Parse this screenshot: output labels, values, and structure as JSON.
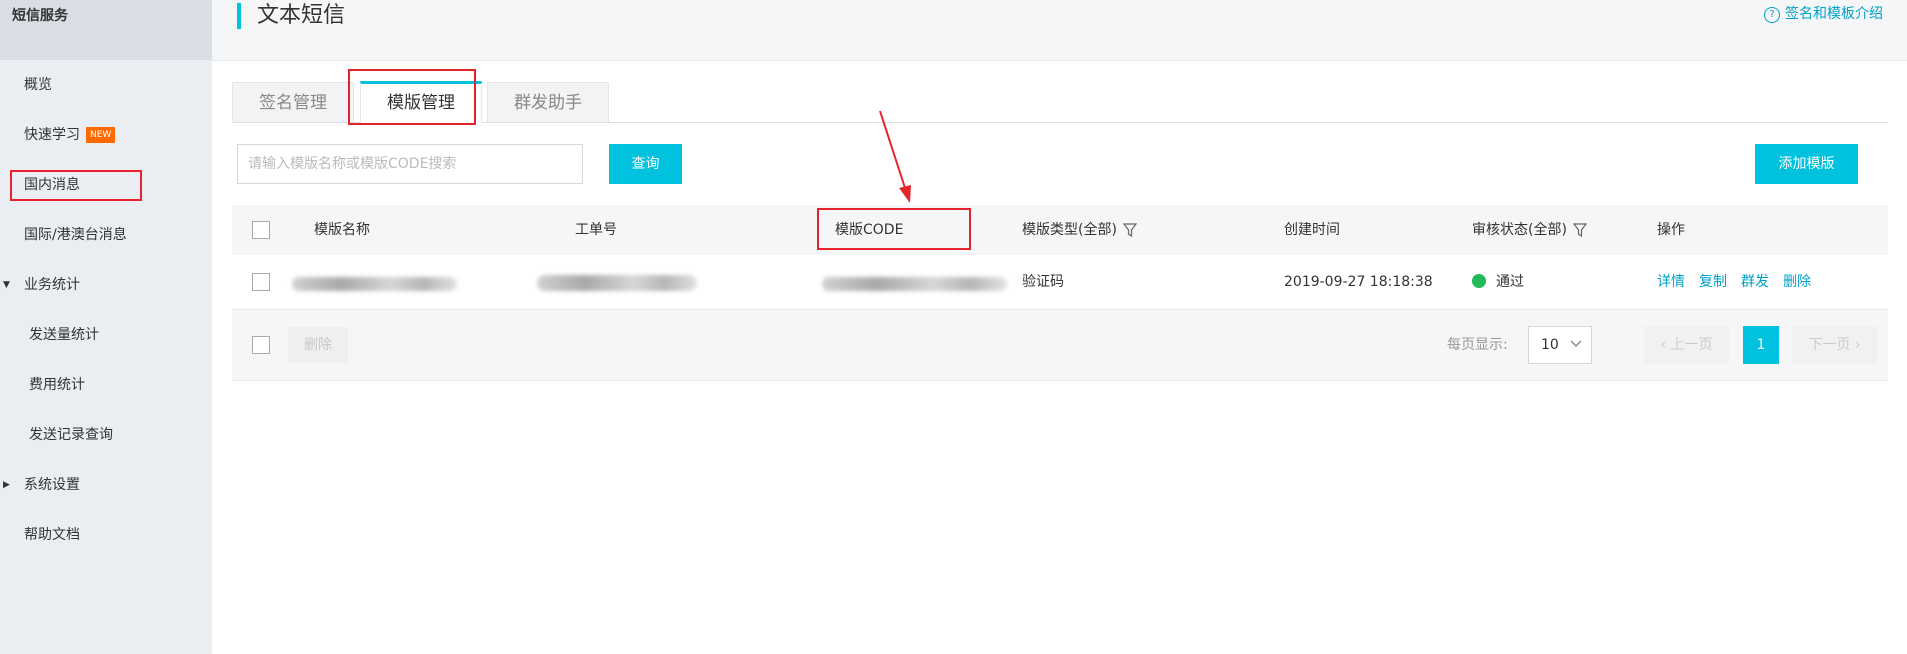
{
  "sidebar": {
    "header": "短信服务",
    "items": [
      {
        "label": "概览"
      },
      {
        "label": "快速学习",
        "badge": "NEW"
      },
      {
        "label": "国内消息"
      },
      {
        "label": "国际/港澳台消息"
      },
      {
        "label": "业务统计"
      },
      {
        "label": "发送量统计"
      },
      {
        "label": "费用统计"
      },
      {
        "label": "发送记录查询"
      },
      {
        "label": "系统设置"
      },
      {
        "label": "帮助文档"
      }
    ]
  },
  "header": {
    "title": "文本短信",
    "help_link": "签名和模板介绍"
  },
  "tabs": [
    {
      "label": "签名管理"
    },
    {
      "label": "模版管理"
    },
    {
      "label": "群发助手"
    }
  ],
  "toolbar": {
    "search_placeholder": "请输入模版名称或模版CODE搜索",
    "search_button": "查询",
    "add_button": "添加模版"
  },
  "table": {
    "columns": [
      "模版名称",
      "工单号",
      "模版CODE",
      "模版类型(全部)",
      "创建时间",
      "审核状态(全部)",
      "操作"
    ],
    "rows": [
      {
        "type": "验证码",
        "created": "2019-09-27 18:18:38",
        "status": "通过",
        "actions": [
          "详情",
          "复制",
          "群发",
          "删除"
        ]
      }
    ]
  },
  "footer": {
    "delete_button": "删除",
    "per_page_label": "每页显示:",
    "per_page_value": "10",
    "prev_label": "上一页",
    "current_page": "1",
    "next_label": "下一页"
  },
  "colors": {
    "accent": "#00c1de",
    "link": "#00a2ca",
    "highlight_box": "#e5232c",
    "status_ok": "#1ebb58",
    "badge": "#ff6a00"
  }
}
